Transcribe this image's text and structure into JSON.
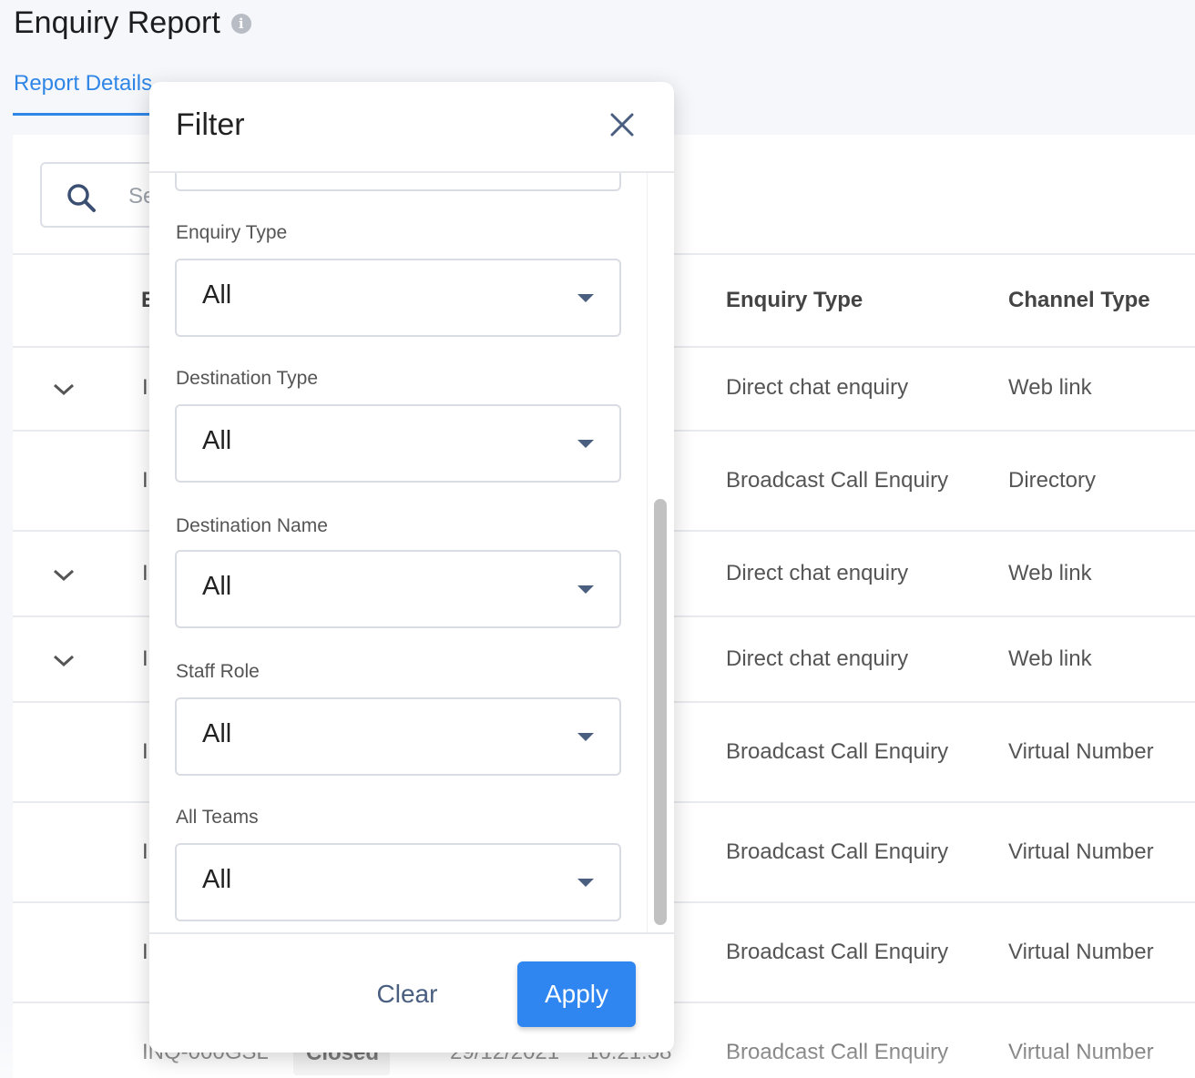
{
  "page": {
    "title": "Enquiry Report",
    "tab": "Report Details"
  },
  "search": {
    "placeholder": "Se"
  },
  "table": {
    "headers": {
      "id_fragment": "E",
      "enquiry_type": "Enquiry Type",
      "channel_type": "Channel Type"
    },
    "rows": [
      {
        "id_fragment": "I",
        "enquiry_type": "Direct chat enquiry",
        "channel_type": "Web link",
        "expandable": true
      },
      {
        "id_fragment": "I",
        "enquiry_type": "Broadcast Call Enquiry",
        "channel_type": "Directory",
        "expandable": false
      },
      {
        "id_fragment": "I",
        "enquiry_type": "Direct chat enquiry",
        "channel_type": "Web link",
        "expandable": true
      },
      {
        "id_fragment": "I",
        "enquiry_type": "Direct chat enquiry",
        "channel_type": "Web link",
        "expandable": true
      },
      {
        "id_fragment": "I",
        "enquiry_type": "Broadcast Call Enquiry",
        "channel_type": "Virtual Number",
        "expandable": false
      },
      {
        "id_fragment": "I",
        "enquiry_type": "Broadcast Call Enquiry",
        "channel_type": "Virtual Number",
        "expandable": false
      },
      {
        "id_fragment": "I",
        "enquiry_type": "Broadcast Call Enquiry",
        "channel_type": "Virtual Number",
        "expandable": false
      },
      {
        "id": "INQ-000GSL",
        "status": "Closed",
        "date": "29/12/2021",
        "time": "10:21:58",
        "enquiry_type": "Broadcast Call Enquiry",
        "channel_type": "Virtual Number"
      }
    ]
  },
  "filter": {
    "title": "Filter",
    "fields": [
      {
        "label": "Enquiry Type",
        "value": "All"
      },
      {
        "label": "Destination Type",
        "value": "All"
      },
      {
        "label": "Destination Name",
        "value": "All"
      },
      {
        "label": "Staff Role",
        "value": "All"
      },
      {
        "label": "All Teams",
        "value": "All"
      }
    ],
    "clear_label": "Clear",
    "apply_label": "Apply"
  },
  "colors": {
    "accent": "#2f86e6",
    "apply_button": "#2f86f0",
    "text_dark": "#222222"
  }
}
